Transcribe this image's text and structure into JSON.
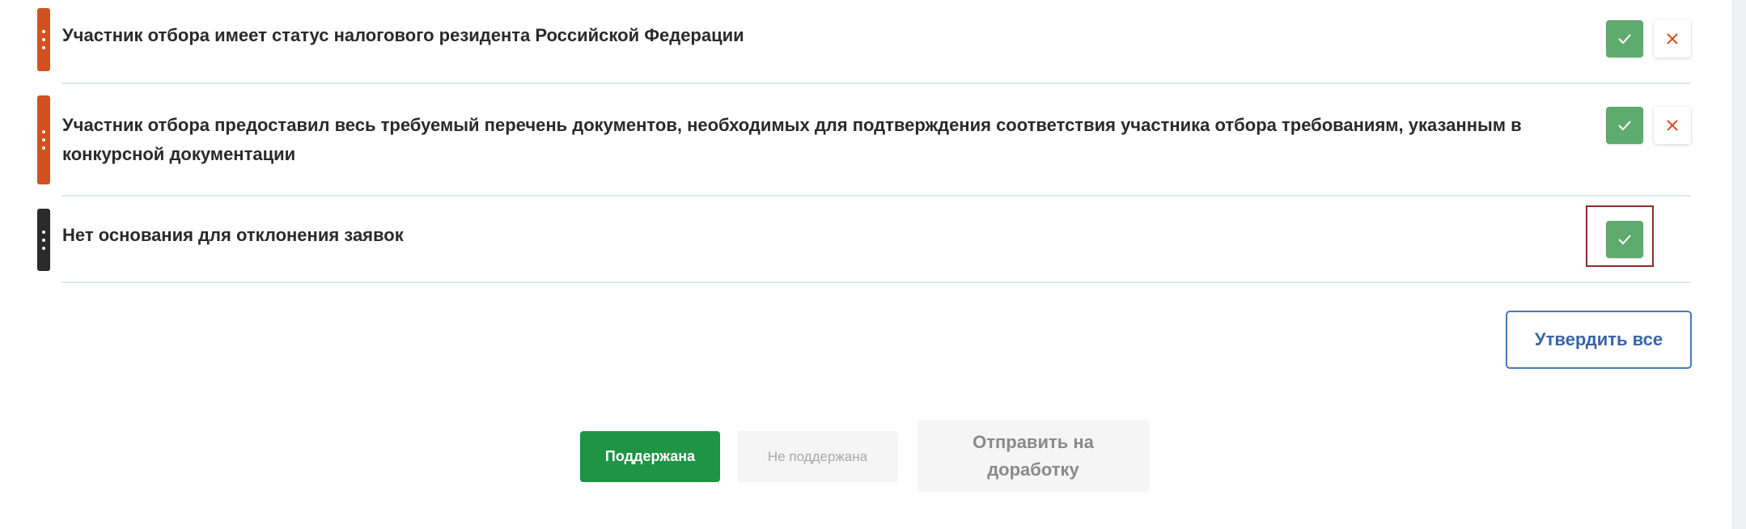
{
  "criteria": [
    {
      "text": "Участник отбора имеет статус налогового резидента Российской Федерации",
      "marker_color": "#d2521f",
      "has_reject": true
    },
    {
      "text": "Участник отбора предоставил весь требуемый перечень документов, необходимых для подтверждения соответствия участника отбора требованиям, указанным в конкурсной документации",
      "marker_color": "#d2521f",
      "has_reject": true
    },
    {
      "text": "Нет основания для отклонения заявок",
      "marker_color": "#2a2a2a",
      "has_reject": false
    }
  ],
  "icons": {
    "approve": "checkmark-icon",
    "reject": "close-icon",
    "handle": "drag-handle-icon"
  },
  "colors": {
    "approve_green": "#5faa6e",
    "reject_orange": "#d2521f",
    "primary_green": "#1f9444",
    "link_blue": "#3a64a8"
  },
  "approve_all_label": "Утвердить все",
  "actions": {
    "supported": "Поддержана",
    "not_supported": "Не поддержана",
    "send_rework": "Отправить на доработку"
  }
}
